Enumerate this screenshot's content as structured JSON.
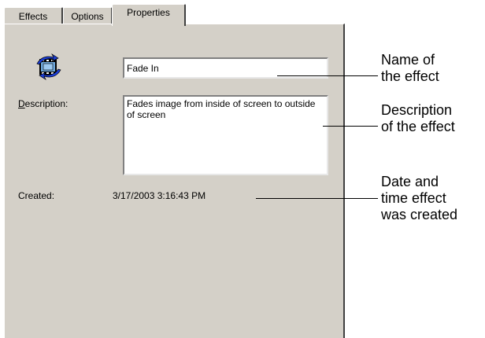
{
  "tabs": [
    {
      "label": "Effects"
    },
    {
      "label": "Options"
    },
    {
      "label": "Properties"
    }
  ],
  "active_tab": "Properties",
  "icon": "film-effect-icon",
  "name": {
    "value": "Fade In"
  },
  "description": {
    "label_first": "D",
    "label_rest": "escription:",
    "value": "Fades image from inside of screen to outside of screen"
  },
  "created": {
    "label": "Created:",
    "value": "3/17/2003 3:16:43 PM"
  },
  "callouts": {
    "name": [
      "Name of",
      "the effect"
    ],
    "description": [
      "Description",
      "of the effect"
    ],
    "created": [
      "Date and",
      "time effect",
      "was created"
    ]
  },
  "colors": {
    "dialog_face": "#d4d0c8",
    "field_bg": "#ffffff",
    "shadow": "#404040"
  }
}
